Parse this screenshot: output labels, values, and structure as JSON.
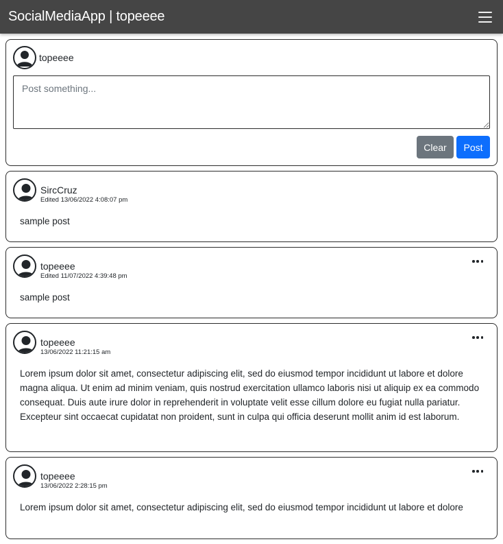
{
  "navbar": {
    "brand": "SocialMediaApp | topeeee"
  },
  "composer": {
    "username": "topeeee",
    "placeholder": "Post something...",
    "value": "",
    "clear_label": "Clear",
    "post_label": "Post"
  },
  "posts": [
    {
      "author": "SircCruz",
      "timestamp": "Edited 13/06/2022 4:08:07 pm",
      "body": "sample post",
      "has_menu": false
    },
    {
      "author": "topeeee",
      "timestamp": "Edited 11/07/2022 4:39:48 pm",
      "body": "sample post",
      "has_menu": true
    },
    {
      "author": "topeeee",
      "timestamp": "13/06/2022 11:21:15 am",
      "body": "Lorem ipsum dolor sit amet, consectetur adipiscing elit, sed do eiusmod tempor incididunt ut labore et dolore magna aliqua. Ut enim ad minim veniam, quis nostrud exercitation ullamco laboris nisi ut aliquip ex ea commodo consequat. Duis aute irure dolor in reprehenderit in voluptate velit esse cillum dolore eu fugiat nulla pariatur. Excepteur sint occaecat cupidatat non proident, sunt in culpa qui officia deserunt mollit anim id est laborum.",
      "has_menu": true
    },
    {
      "author": "topeeee",
      "timestamp": "13/06/2022 2:28:15 pm",
      "body": "Lorem ipsum dolor sit amet, consectetur adipiscing elit, sed do eiusmod tempor incididunt ut labore et dolore",
      "has_menu": true
    }
  ],
  "icons": {
    "avatar": "person-circle-icon",
    "menu": "hamburger-menu-icon",
    "post_options": "three-dots-icon"
  },
  "colors": {
    "navbar_bg": "#454545",
    "clear_button": "#6c757d",
    "post_button": "#0d6efd"
  }
}
